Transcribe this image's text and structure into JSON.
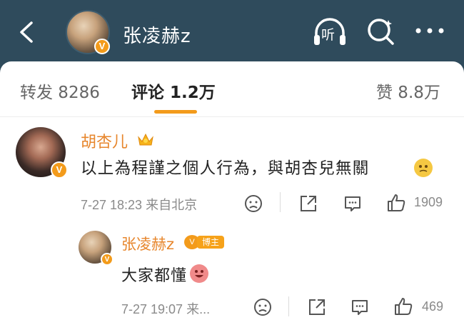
{
  "header": {
    "name": "张凌赫z",
    "listen_label": "听",
    "verified_badge": "V",
    "bg_color": "#2f4b5c"
  },
  "tabs": [
    {
      "label": "转发 8286"
    },
    {
      "label": "评论 1.2万"
    },
    {
      "label": "赞 8.8万"
    }
  ],
  "comments": [
    {
      "name": "胡杏儿",
      "text": "以上為程謹之個人行為，與胡杏兒無關",
      "meta": "7-27 18:23  来自北京",
      "likes": "1909"
    }
  ],
  "reply": {
    "name": "张凌赫z",
    "badge": "博主",
    "text": "大家都懂",
    "meta": "7-27 19:07  来...",
    "likes": "469"
  },
  "accent_color": "#f39b1b",
  "name_color": "#e7862c"
}
